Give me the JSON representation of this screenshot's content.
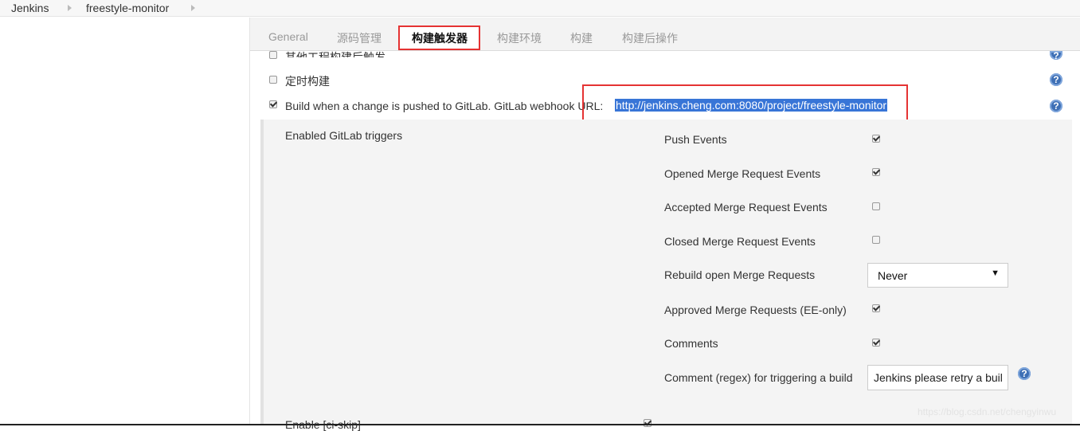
{
  "breadcrumb": {
    "items": [
      "Jenkins",
      "freestyle-monitor"
    ]
  },
  "tabs": [
    {
      "label": "General"
    },
    {
      "label": "源码管理"
    },
    {
      "label": "构建触发器"
    },
    {
      "label": "构建环境"
    },
    {
      "label": "构建"
    },
    {
      "label": "构建后操作"
    }
  ],
  "triggers": {
    "other_projects": {
      "label": "其他工程构建后触发",
      "checked": false
    },
    "periodic": {
      "label": "定时构建",
      "checked": false
    },
    "gitlab": {
      "label": "Build when a change is pushed to GitLab. GitLab webhook URL:",
      "url": "http://jenkins.cheng.com:8080/project/freestyle-monitor",
      "checked": true
    }
  },
  "gitlab_panel": {
    "title": "Enabled GitLab triggers",
    "options": [
      {
        "label": "Push Events",
        "checked": true
      },
      {
        "label": "Opened Merge Request Events",
        "checked": true
      },
      {
        "label": "Accepted Merge Request Events",
        "checked": false
      },
      {
        "label": "Closed Merge Request Events",
        "checked": false
      },
      {
        "label": "Rebuild open Merge Requests",
        "value": "Never"
      },
      {
        "label": "Approved Merge Requests (EE-only)",
        "checked": true
      },
      {
        "label": "Comments",
        "checked": true
      },
      {
        "label": "Comment (regex) for triggering a build",
        "value": "Jenkins please retry a build"
      }
    ],
    "ci_skip": {
      "label": "Enable [ci-skip]",
      "checked": true
    }
  },
  "watermark": "https://blog.csdn.net/chengyinwu",
  "colors": {
    "highlight_red": "#e53333",
    "link_selected_bg": "#3875d7",
    "help_icon": "#3e6fb5"
  }
}
